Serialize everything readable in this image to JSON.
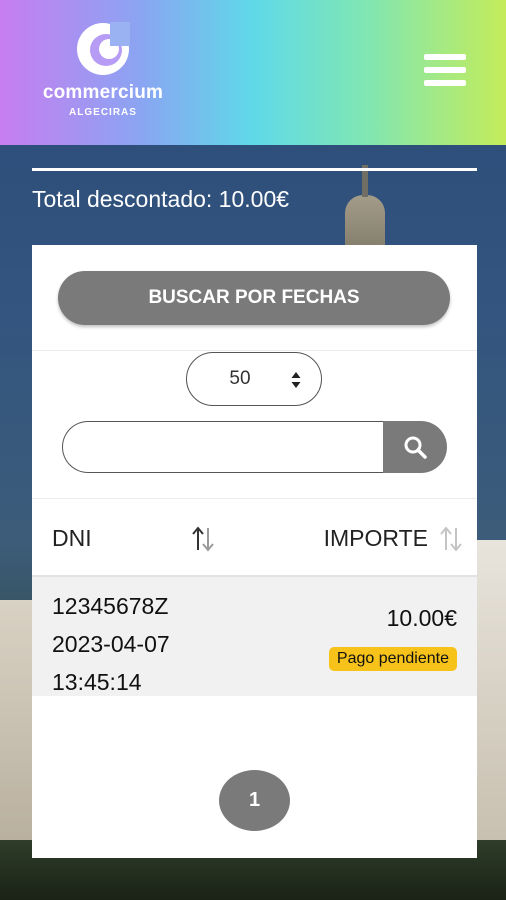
{
  "header": {
    "brand_name": "commercium",
    "brand_sub": "ALGECIRAS"
  },
  "summary": {
    "total_label": "Total descontado: 10.00€"
  },
  "filters": {
    "search_dates_label": "BUSCAR POR FECHAS",
    "page_size": "50",
    "search_value": ""
  },
  "table": {
    "columns": [
      "DNI",
      "IMPORTE"
    ],
    "rows": [
      {
        "dni": "12345678Z",
        "date": "2023-04-07",
        "time": "13:45:14",
        "amount": "10.00€",
        "status": "Pago pendiente"
      }
    ]
  },
  "pagination": {
    "current_page": "1"
  },
  "colors": {
    "button_gray": "#7a7a7a",
    "badge_yellow": "#f7c31b",
    "row_bg": "#f1f1f1"
  },
  "icons": {
    "menu": "hamburger-icon",
    "search": "search-icon",
    "select_arrows": "select-arrows-icon",
    "sort": "sort-icon"
  }
}
